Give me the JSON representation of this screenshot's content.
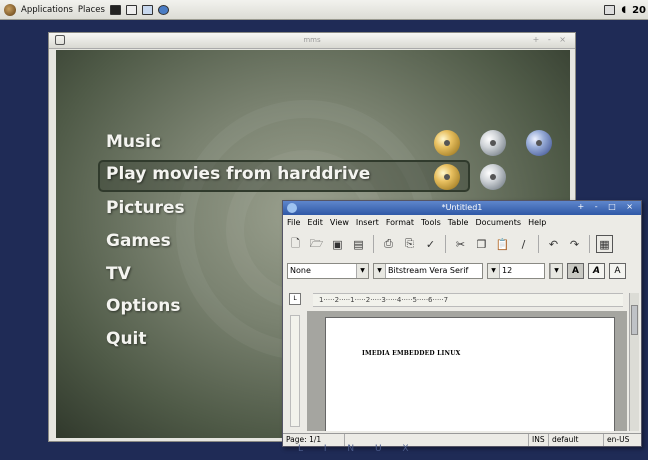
{
  "panel": {
    "applications": "Applications",
    "places": "Places",
    "clock": "20"
  },
  "mms": {
    "title": "mms",
    "menu": [
      {
        "label": "Music"
      },
      {
        "label": "Play movies from harddrive"
      },
      {
        "label": "Pictures"
      },
      {
        "label": "Games"
      },
      {
        "label": "TV"
      },
      {
        "label": "Options"
      },
      {
        "label": "Quit"
      }
    ],
    "selected_index": 1
  },
  "writer": {
    "title": "*Untitled1",
    "menu": [
      "File",
      "Edit",
      "View",
      "Insert",
      "Format",
      "Tools",
      "Table",
      "Documents",
      "Help"
    ],
    "style_value": "None",
    "font_value": "Bitstream Vera Serif",
    "size_value": "12",
    "ruler_text": "1·····2·····1·····2·····3·····4·····5·····6·····7",
    "document_text": "IMEDIA EMBEDDED LINUX",
    "status": {
      "page": "Page: 1/1",
      "mode": "INS",
      "style": "default",
      "lang": "en-US"
    }
  },
  "bottom_glyphs": "L I N U X",
  "colors": {
    "desktop_bg": "#1f2b56",
    "mms_gradient_center": "#9aa08e",
    "writer_titlebar": "#2f58a6"
  }
}
